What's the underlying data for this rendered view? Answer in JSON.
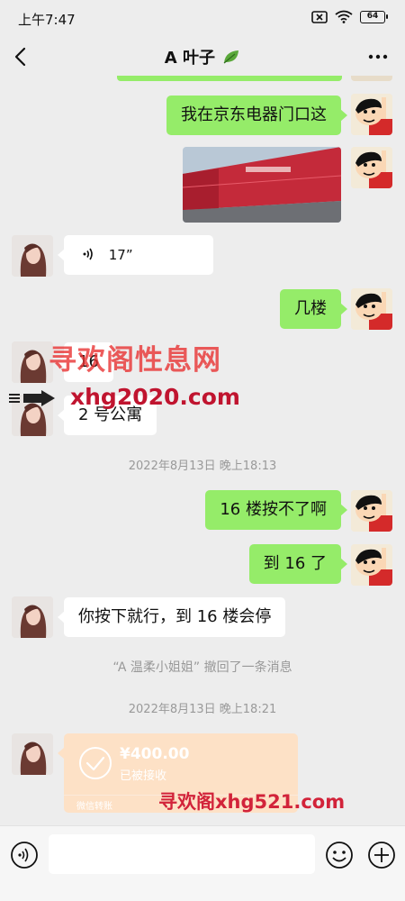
{
  "status_bar": {
    "time": "上午7:47",
    "battery": "64"
  },
  "nav": {
    "title": "A 叶子"
  },
  "messages": [
    {
      "side": "mine",
      "type": "text",
      "text": "我在京东电器门口这"
    },
    {
      "side": "mine",
      "type": "image"
    },
    {
      "side": "other",
      "type": "voice",
      "duration": "17”"
    },
    {
      "side": "mine",
      "type": "text",
      "text": "几楼"
    },
    {
      "side": "other",
      "type": "text",
      "text": "16"
    },
    {
      "side": "other",
      "type": "text",
      "text": "2 号公寓"
    },
    {
      "side": "mine",
      "type": "text",
      "text": "16 楼按不了啊"
    },
    {
      "side": "mine",
      "type": "text",
      "text": "到 16 了"
    },
    {
      "side": "other",
      "type": "text",
      "text": "你按下就行，到 16 楼会停"
    }
  ],
  "timestamps": {
    "first": "2022年8月13日 晚上18:13",
    "second": "2022年8月13日 晚上18:21"
  },
  "recall_notice": "“A 温柔小姐姐” 撤回了一条消息",
  "transfer": {
    "amount": "¥400.00",
    "status": "已被接收",
    "label": "微信转账"
  },
  "watermarks": {
    "cn": "寻欢阁性息网",
    "url": "xhg2020.com",
    "bottom": "寻欢阁xhg521.com"
  },
  "colors": {
    "background": "#ededed",
    "my_bubble": "#95ec69",
    "other_bubble": "#ffffff",
    "transfer_card": "#fde1c6",
    "watermark_red": "#d2233a"
  },
  "icons": [
    "back-arrow-icon",
    "more-dots-icon",
    "leaf-icon",
    "voice-wave-icon",
    "check-circle-icon",
    "voice-input-icon",
    "emoji-icon",
    "plus-icon",
    "wifi-icon",
    "mute-icon"
  ]
}
